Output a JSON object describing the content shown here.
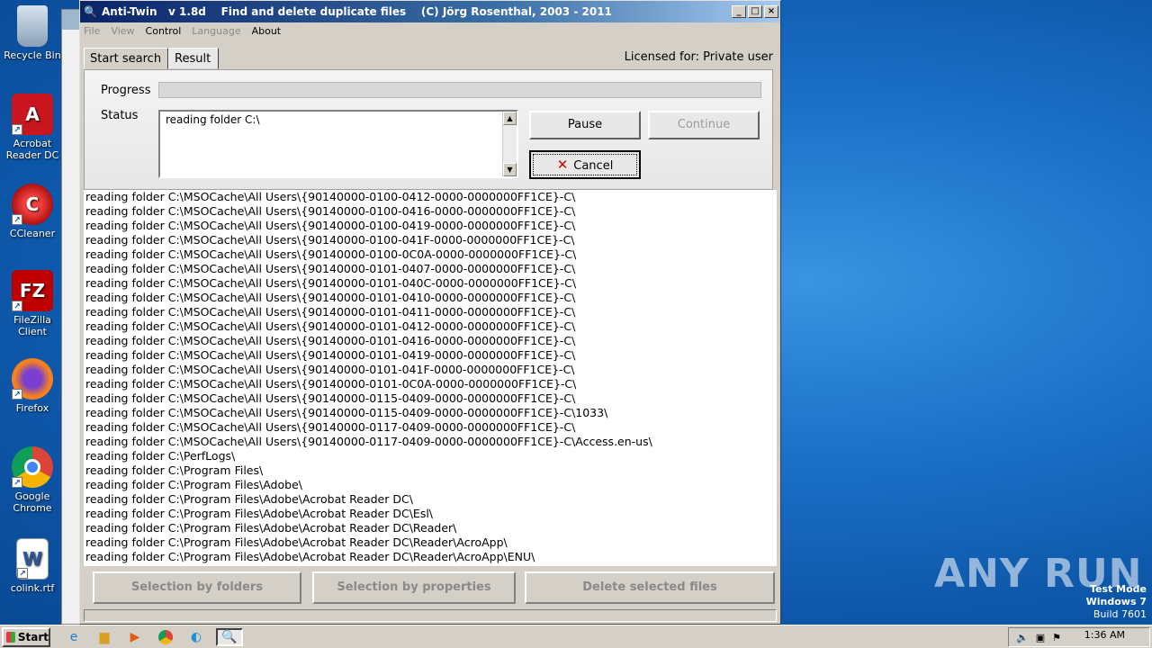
{
  "desktop": {
    "icons": [
      {
        "label": "Recycle Bin",
        "icon": "recycle-bin-icon"
      },
      {
        "label": "Acrobat Reader DC",
        "icon": "acrobat-icon"
      },
      {
        "label": "CCleaner",
        "icon": "ccleaner-icon"
      },
      {
        "label": "FileZilla Client",
        "icon": "filezilla-icon"
      },
      {
        "label": "Firefox",
        "icon": "firefox-icon"
      },
      {
        "label": "Google Chrome",
        "icon": "chrome-icon"
      },
      {
        "label": "colink.rtf",
        "icon": "word-document-icon"
      }
    ],
    "watermark": "ANY RUN",
    "test_mode": {
      "line1": "Test Mode",
      "line2": "Windows 7",
      "line3": "Build 7601"
    }
  },
  "window": {
    "title": "Anti-Twin   v 1.8d    Find and delete duplicate files    (C) Jörg Rosenthal, 2003 - 2011",
    "menu": [
      "File",
      "View",
      "Control",
      "Language",
      "About"
    ],
    "tabs": [
      "Start search",
      "Result"
    ],
    "licensed": "Licensed for: Private user",
    "progress_label": "Progress",
    "progress_value": 0,
    "status_label": "Status",
    "status_text": "reading folder C:\\",
    "pause_label": "Pause",
    "continue_label": "Continue",
    "cancel_label": "Cancel",
    "log_lines": [
      "reading folder C:\\MSOCache\\All Users\\{90140000-0100-0412-0000-0000000FF1CE}-C\\",
      "reading folder C:\\MSOCache\\All Users\\{90140000-0100-0416-0000-0000000FF1CE}-C\\",
      "reading folder C:\\MSOCache\\All Users\\{90140000-0100-0419-0000-0000000FF1CE}-C\\",
      "reading folder C:\\MSOCache\\All Users\\{90140000-0100-041F-0000-0000000FF1CE}-C\\",
      "reading folder C:\\MSOCache\\All Users\\{90140000-0100-0C0A-0000-0000000FF1CE}-C\\",
      "reading folder C:\\MSOCache\\All Users\\{90140000-0101-0407-0000-0000000FF1CE}-C\\",
      "reading folder C:\\MSOCache\\All Users\\{90140000-0101-040C-0000-0000000FF1CE}-C\\",
      "reading folder C:\\MSOCache\\All Users\\{90140000-0101-0410-0000-0000000FF1CE}-C\\",
      "reading folder C:\\MSOCache\\All Users\\{90140000-0101-0411-0000-0000000FF1CE}-C\\",
      "reading folder C:\\MSOCache\\All Users\\{90140000-0101-0412-0000-0000000FF1CE}-C\\",
      "reading folder C:\\MSOCache\\All Users\\{90140000-0101-0416-0000-0000000FF1CE}-C\\",
      "reading folder C:\\MSOCache\\All Users\\{90140000-0101-0419-0000-0000000FF1CE}-C\\",
      "reading folder C:\\MSOCache\\All Users\\{90140000-0101-041F-0000-0000000FF1CE}-C\\",
      "reading folder C:\\MSOCache\\All Users\\{90140000-0101-0C0A-0000-0000000FF1CE}-C\\",
      "reading folder C:\\MSOCache\\All Users\\{90140000-0115-0409-0000-0000000FF1CE}-C\\",
      "reading folder C:\\MSOCache\\All Users\\{90140000-0115-0409-0000-0000000FF1CE}-C\\1033\\",
      "reading folder C:\\MSOCache\\All Users\\{90140000-0117-0409-0000-0000000FF1CE}-C\\",
      "reading folder C:\\MSOCache\\All Users\\{90140000-0117-0409-0000-0000000FF1CE}-C\\Access.en-us\\",
      "reading folder C:\\PerfLogs\\",
      "reading folder C:\\Program Files\\",
      "reading folder C:\\Program Files\\Adobe\\",
      "reading folder C:\\Program Files\\Adobe\\Acrobat Reader DC\\",
      "reading folder C:\\Program Files\\Adobe\\Acrobat Reader DC\\Esl\\",
      "reading folder C:\\Program Files\\Adobe\\Acrobat Reader DC\\Reader\\",
      "reading folder C:\\Program Files\\Adobe\\Acrobat Reader DC\\Reader\\AcroApp\\",
      "reading folder C:\\Program Files\\Adobe\\Acrobat Reader DC\\Reader\\AcroApp\\ENU\\"
    ],
    "selection_by_folders": "Selection by folders",
    "selection_by_properties": "Selection by properties",
    "delete_selected": "Delete selected files"
  },
  "taskbar": {
    "start_label": "Start",
    "time": "1:36 AM"
  }
}
